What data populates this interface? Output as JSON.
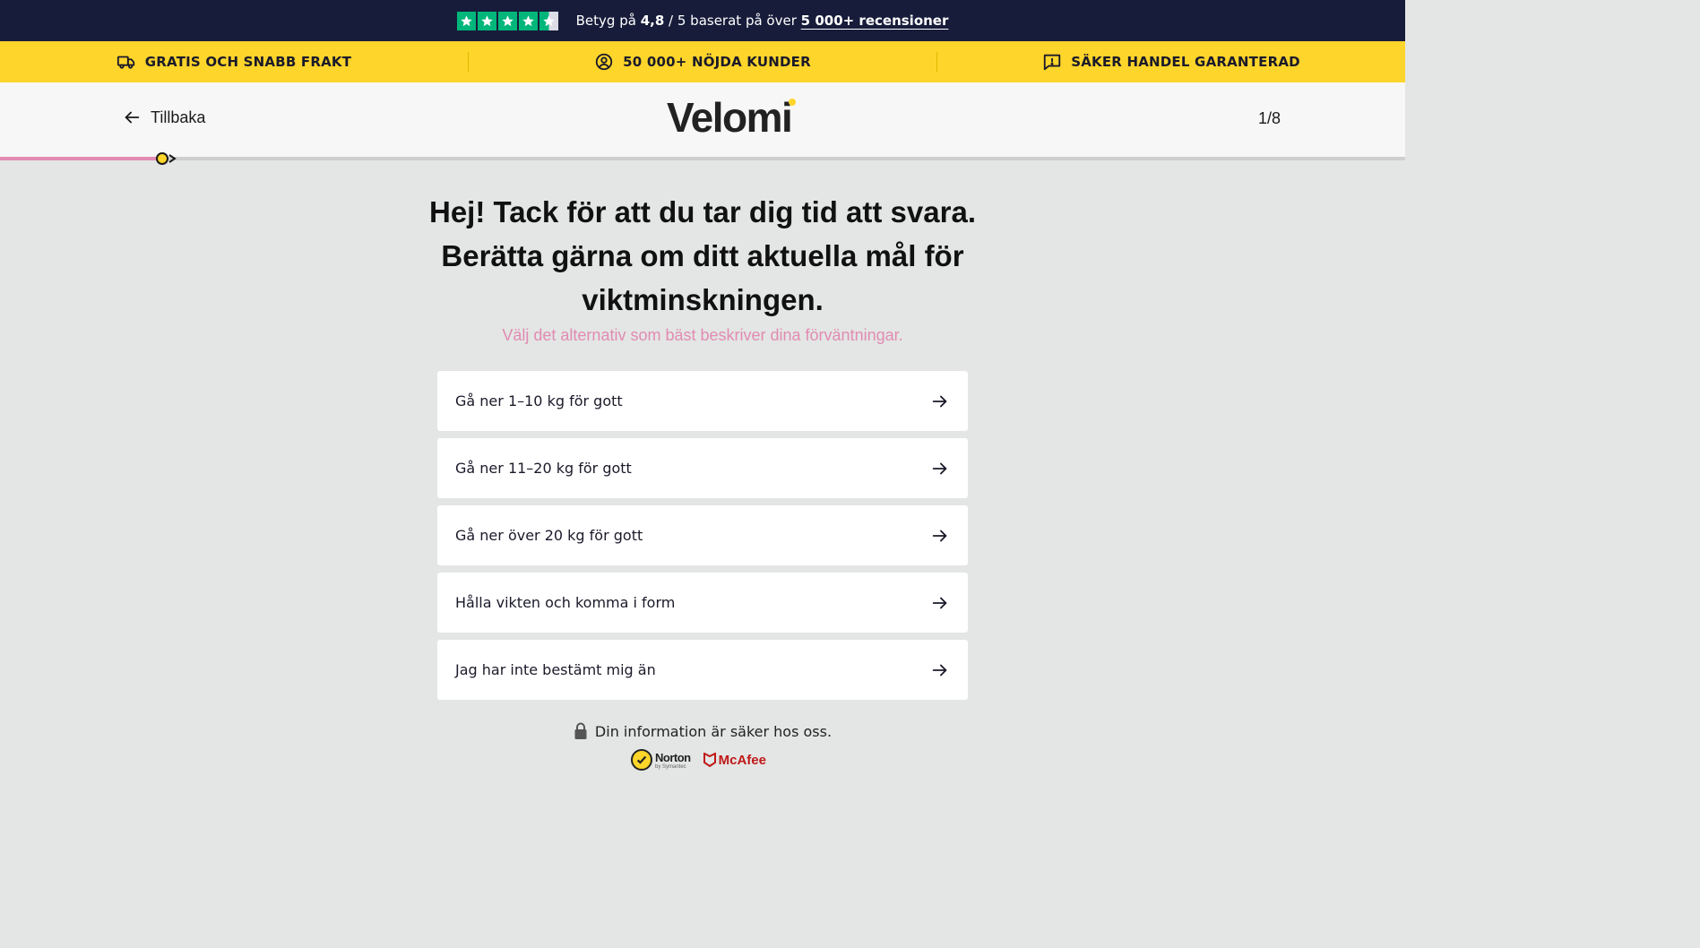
{
  "trust_bar": {
    "rating_prefix": "Betyg på",
    "rating_value": "4,8",
    "rating_middle": "/ 5 baserat på över",
    "reviews_link": "5 000+ recensioner",
    "stars": 4.5,
    "star_color": "#00b67a",
    "background": "#171c3a"
  },
  "usp_bar": {
    "background": "#fed52a",
    "items": [
      {
        "icon": "truck-icon",
        "label": "GRATIS OCH SNABB FRAKT"
      },
      {
        "icon": "user-circle-icon",
        "label": "50 000+ NÖJDA KUNDER"
      },
      {
        "icon": "message-alert-icon",
        "label": "SÄKER HANDEL GARANTERAD"
      }
    ]
  },
  "header": {
    "back_label": "Tillbaka",
    "logo": "Velomi",
    "step": "1/8"
  },
  "progress": {
    "current": 1,
    "total": 8,
    "fraction": 0.115,
    "fill_color": "#e28bb3"
  },
  "question": {
    "title_line1": "Hej! Tack för att du tar dig tid att svara.",
    "title_line2": "Berätta gärna om ditt aktuella mål för",
    "title_line3": "viktminskningen.",
    "subtitle": "Välj det alternativ som bäst beskriver dina förväntningar."
  },
  "options": [
    {
      "label": "Gå ner 1–10 kg för gott"
    },
    {
      "label": "Gå ner 11–20 kg för gott"
    },
    {
      "label": "Gå ner över 20 kg för gott"
    },
    {
      "label": "Hålla vikten och komma i form"
    },
    {
      "label": "Jag har inte bestämt mig än"
    }
  ],
  "footer": {
    "secure_text": "Din information är säker hos oss.",
    "norton": "Norton",
    "norton_sub": "by Symantec",
    "mcafee": "McAfee"
  }
}
